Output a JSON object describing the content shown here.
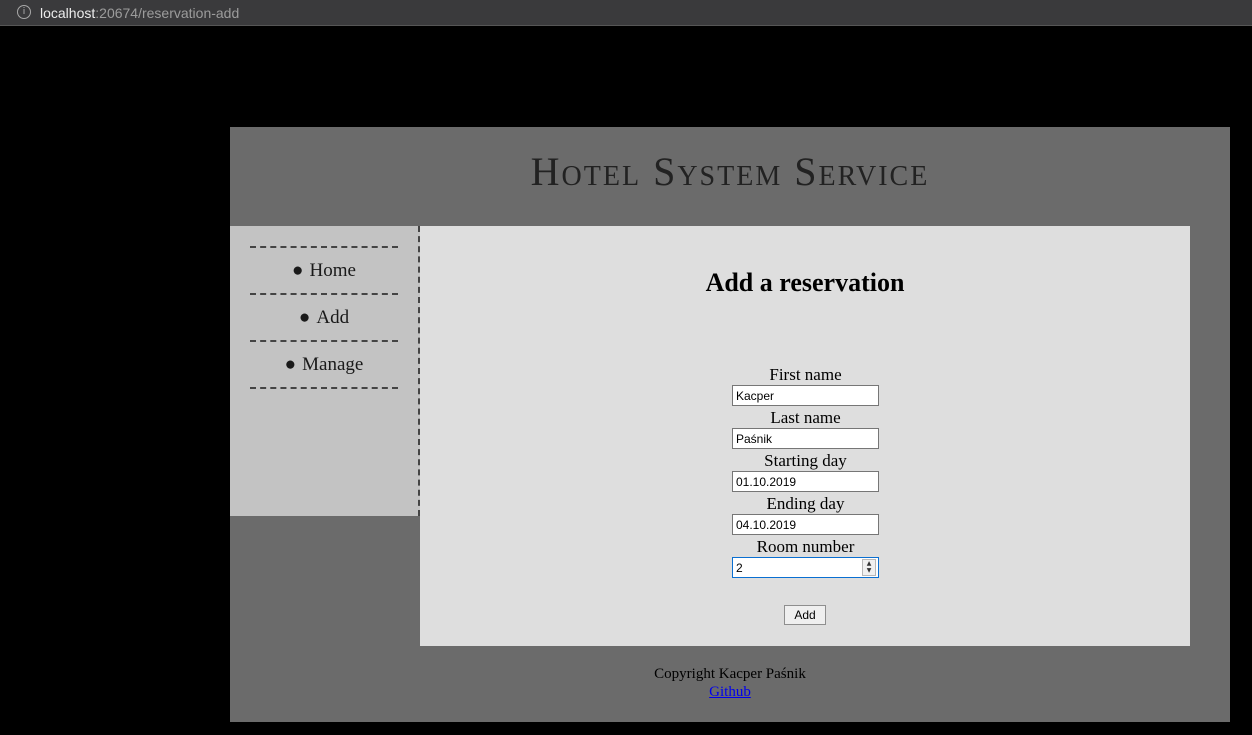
{
  "browser": {
    "url_host": "localhost",
    "url_rest": ":20674/reservation-add",
    "info_icon": "i"
  },
  "site": {
    "title": "Hotel System Service"
  },
  "sidebar": {
    "items": [
      {
        "bullet": "●",
        "label": "Home"
      },
      {
        "bullet": "●",
        "label": "Add"
      },
      {
        "bullet": "●",
        "label": "Manage"
      }
    ]
  },
  "main": {
    "title": "Add a reservation",
    "form": {
      "first_name": {
        "label": "First name",
        "value": "Kacper"
      },
      "last_name": {
        "label": "Last name",
        "value": "Paśnik"
      },
      "start_day": {
        "label": "Starting day",
        "value": "01.10.2019"
      },
      "end_day": {
        "label": "Ending day",
        "value": "04.10.2019"
      },
      "room_number": {
        "label": "Room number",
        "value": "2"
      },
      "submit_label": "Add"
    }
  },
  "footer": {
    "copyright": "Copyright Kacper Paśnik",
    "link_label": "Github"
  }
}
